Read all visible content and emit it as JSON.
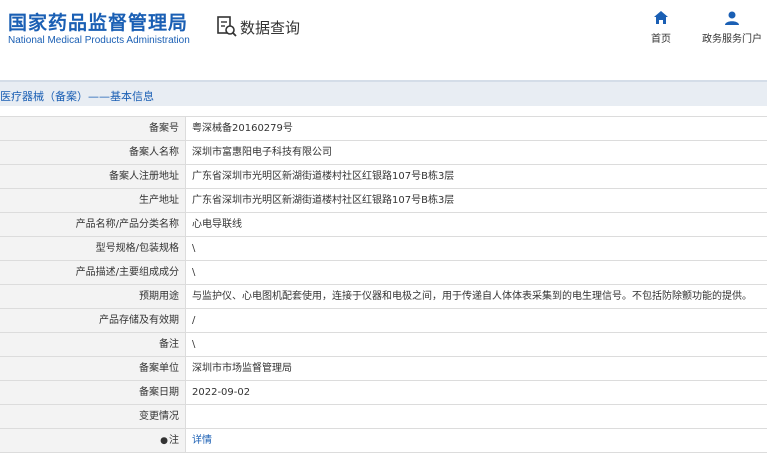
{
  "header": {
    "logo_cn": "国家药品监督管理局",
    "logo_en": "National Medical Products Administration",
    "search_title": "数据查询",
    "nav": {
      "home": "首页",
      "service": "政务服务门户"
    }
  },
  "section": {
    "title": "医疗器械（备案）——基本信息"
  },
  "rows": [
    {
      "label": "备案号",
      "value": "粤深械备20160279号"
    },
    {
      "label": "备案人名称",
      "value": "深圳市富惠阳电子科技有限公司"
    },
    {
      "label": "备案人注册地址",
      "value": "广东省深圳市光明区新湖街道楼村社区红银路107号B栋3层"
    },
    {
      "label": "生产地址",
      "value": "广东省深圳市光明区新湖街道楼村社区红银路107号B栋3层"
    },
    {
      "label": "产品名称/产品分类名称",
      "value": "心电导联线"
    },
    {
      "label": "型号规格/包装规格",
      "value": "\\"
    },
    {
      "label": "产品描述/主要组成成分",
      "value": "\\"
    },
    {
      "label": "预期用途",
      "value": "与监护仪、心电图机配套使用，连接于仪器和电极之间，用于传递自人体体表采集到的电生理信号。不包括防除颤功能的提供。"
    },
    {
      "label": "产品存储及有效期",
      "value": "/"
    },
    {
      "label": "备注",
      "value": "\\"
    },
    {
      "label": "备案单位",
      "value": "深圳市市场监督管理局"
    },
    {
      "label": "备案日期",
      "value": "2022-09-02"
    },
    {
      "label": "变更情况",
      "value": ""
    },
    {
      "label": "注",
      "value": "详情"
    }
  ],
  "colors": {
    "brand_blue": "#1a5fb4",
    "label_bg": "#f3f3f3",
    "section_bg": "#e8edf3"
  }
}
